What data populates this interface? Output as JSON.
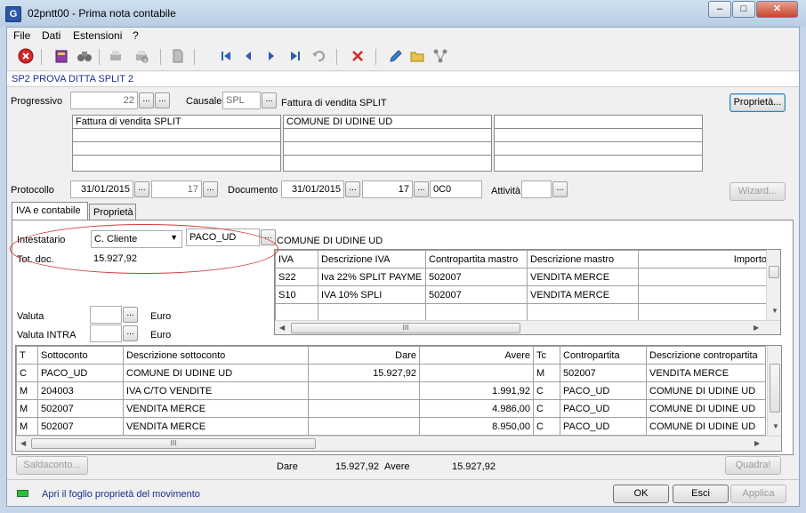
{
  "window": {
    "title": "02pntt00 - Prima nota contabile",
    "app_icon": "G",
    "minimize": "–",
    "maximize": "□",
    "close": "✕"
  },
  "menu": [
    "File",
    "Dati",
    "Estensioni",
    "?"
  ],
  "company": "SP2 PROVA DITTA SPLIT 2",
  "header": {
    "progressivo_label": "Progressivo",
    "progressivo_value": "22",
    "causale_label": "Causale",
    "causale_code": "SPL",
    "causale_desc": "Fattura di vendita SPLIT",
    "proprieta_button": "Proprietà...",
    "desc_box1": [
      "Fattura di vendita SPLIT",
      "",
      "",
      ""
    ],
    "desc_box2": [
      "COMUNE DI UDINE UD",
      "",
      "",
      ""
    ],
    "desc_box3": [
      "",
      "",
      "",
      ""
    ],
    "protocollo_label": "Protocollo",
    "protocollo_date": "31/01/2015",
    "protocollo_num": "17",
    "documento_label": "Documento",
    "documento_date": "31/01/2015",
    "documento_num": "17",
    "documento_suffix": "0C0",
    "attivita_label": "Attività",
    "wizard_button": "Wizard..."
  },
  "tabs": [
    "IVA e contabile",
    "Proprietà"
  ],
  "iva_panel": {
    "intestatario_label": "Intestatario",
    "intestatario_type": "C. Cliente",
    "intestatario_code": "PACO_UD",
    "intestatario_name": "COMUNE DI UDINE UD",
    "totdoc_label": "Tot. doc.",
    "totdoc_value": "15.927,92",
    "valuta_label": "Valuta",
    "valuta_unit": "Euro",
    "valuta_intra_label": "Valuta INTRA",
    "valuta_intra_unit": "Euro"
  },
  "iva_table": {
    "columns": [
      "IVA",
      "Descrizione IVA",
      "Contropartita mastro",
      "Descrizione mastro",
      "Importo"
    ],
    "rows": [
      [
        "S22",
        "Iva 22% SPLIT PAYME",
        "502007",
        "VENDITA MERCE",
        ""
      ],
      [
        "S10",
        "IVA 10% SPLI",
        "502007",
        "VENDITA MERCE",
        ""
      ],
      [
        "",
        "",
        "",
        "",
        ""
      ]
    ]
  },
  "accounts_table": {
    "columns": [
      "T",
      "Sottoconto",
      "Descrizione sottoconto",
      "Dare",
      "Avere",
      "Tc",
      "Contropartita",
      "Descrizione contropartita"
    ],
    "rows": [
      [
        "C",
        "PACO_UD",
        "COMUNE DI UDINE UD",
        "15.927,92",
        "",
        "M",
        "502007",
        "VENDITA MERCE"
      ],
      [
        "M",
        "204003",
        "IVA C/TO VENDITE",
        "",
        "1.991,92",
        "C",
        "PACO_UD",
        "COMUNE DI UDINE UD"
      ],
      [
        "M",
        "502007",
        "VENDITA MERCE",
        "",
        "4.986,00",
        "C",
        "PACO_UD",
        "COMUNE DI UDINE UD"
      ],
      [
        "M",
        "502007",
        "VENDITA MERCE",
        "",
        "8.950,00",
        "C",
        "PACO_UD",
        "COMUNE DI UDINE UD"
      ]
    ]
  },
  "totals": {
    "saldaconto_button": "Saldaconto...",
    "dare_label": "Dare",
    "dare_value": "15.927,92",
    "avere_label": "Avere",
    "avere_value": "15.927,92",
    "quadra_button": "Quadra!"
  },
  "statusbar": {
    "text": "Apri il foglio proprietà del movimento",
    "ok": "OK",
    "esci": "Esci",
    "applica": "Applica"
  },
  "scroll_glyph": "III",
  "ellipsis": "...",
  "colors": {
    "accent_blue": "#1a2f8e",
    "annotation_red": "#d43b3b",
    "status_led": "#2ebd3d"
  }
}
